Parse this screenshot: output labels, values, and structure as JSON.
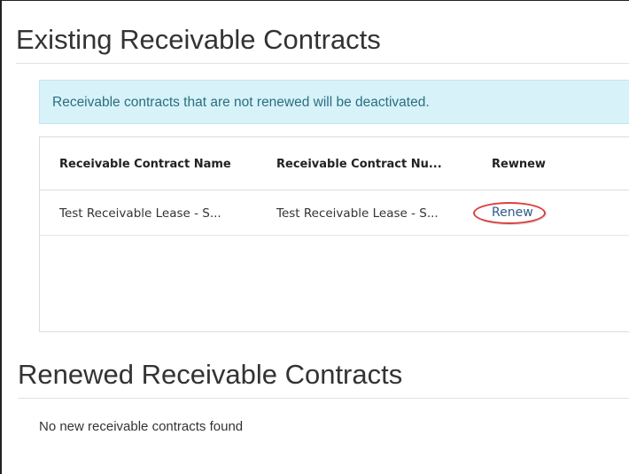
{
  "existing": {
    "title": "Existing Receivable Contracts",
    "alert": "Receivable contracts that are not renewed will be deactivated.",
    "table": {
      "headers": [
        "Receivable Contract Name",
        "Receivable Contract Nu...",
        "Rewnew"
      ],
      "rows": [
        {
          "name": "Test Receivable Lease - S...",
          "number": "Test Receivable Lease - S...",
          "action": "Renew"
        }
      ]
    }
  },
  "renewed": {
    "title": "Renewed Receivable Contracts",
    "empty_message": "No new receivable contracts found"
  },
  "colors": {
    "alert_background": "#d7f2f9",
    "alert_text": "#2a6f80",
    "link": "#2d5b8a",
    "highlight": "#d9403e"
  }
}
